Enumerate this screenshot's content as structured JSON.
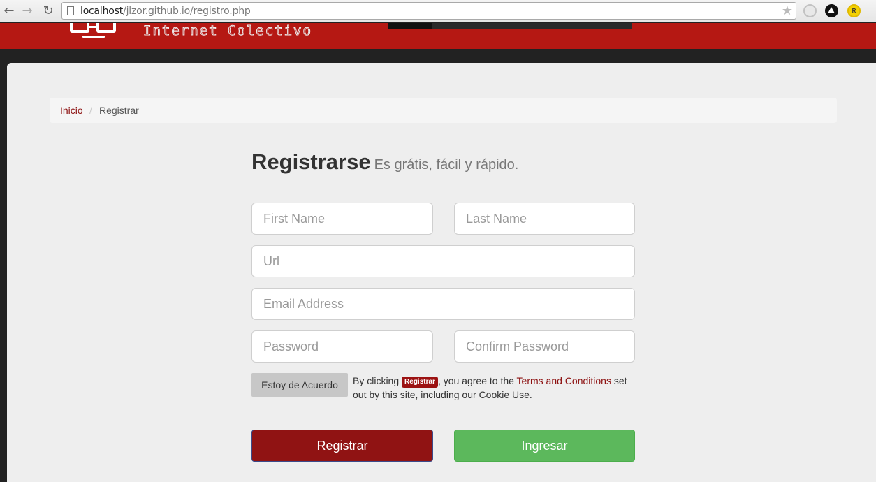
{
  "browser": {
    "url_host": "localhost",
    "url_path": "/jlzor.github.io/registro.php",
    "back_glyph": "←",
    "forward_glyph": "→",
    "reload_glyph": "↻",
    "star_glyph": "★",
    "extension_letter": "R"
  },
  "site": {
    "logo_text": "Internet Colectivo",
    "header_color": "#b51813"
  },
  "breadcrumb": {
    "home": "Inicio",
    "separator": "/",
    "current": "Registrar"
  },
  "heading": {
    "title": "Registrarse",
    "subtitle": "Es grátis, fácil y rápido."
  },
  "form": {
    "first_name_placeholder": "First Name",
    "last_name_placeholder": "Last Name",
    "url_placeholder": "Url",
    "email_placeholder": "Email Address",
    "password_placeholder": "Password",
    "confirm_password_placeholder": "Confirm Password",
    "agree_button": "Estoy de Acuerdo",
    "terms_prefix": "By clicking",
    "terms_badge": "Registrar",
    "terms_middle": ", you agree to the",
    "terms_link": "Terms and Conditions",
    "terms_suffix": "set out by this site, including our Cookie Use."
  },
  "actions": {
    "register_label": "Registrar",
    "login_label": "Ingresar",
    "register_color": "#901313",
    "login_color": "#5cb85c"
  },
  "icons": {
    "back": "back-arrow-icon",
    "forward": "forward-arrow-icon",
    "reload": "reload-icon",
    "page": "page-icon",
    "bookmark": "star-icon",
    "logo": "glasses-logo-icon"
  }
}
